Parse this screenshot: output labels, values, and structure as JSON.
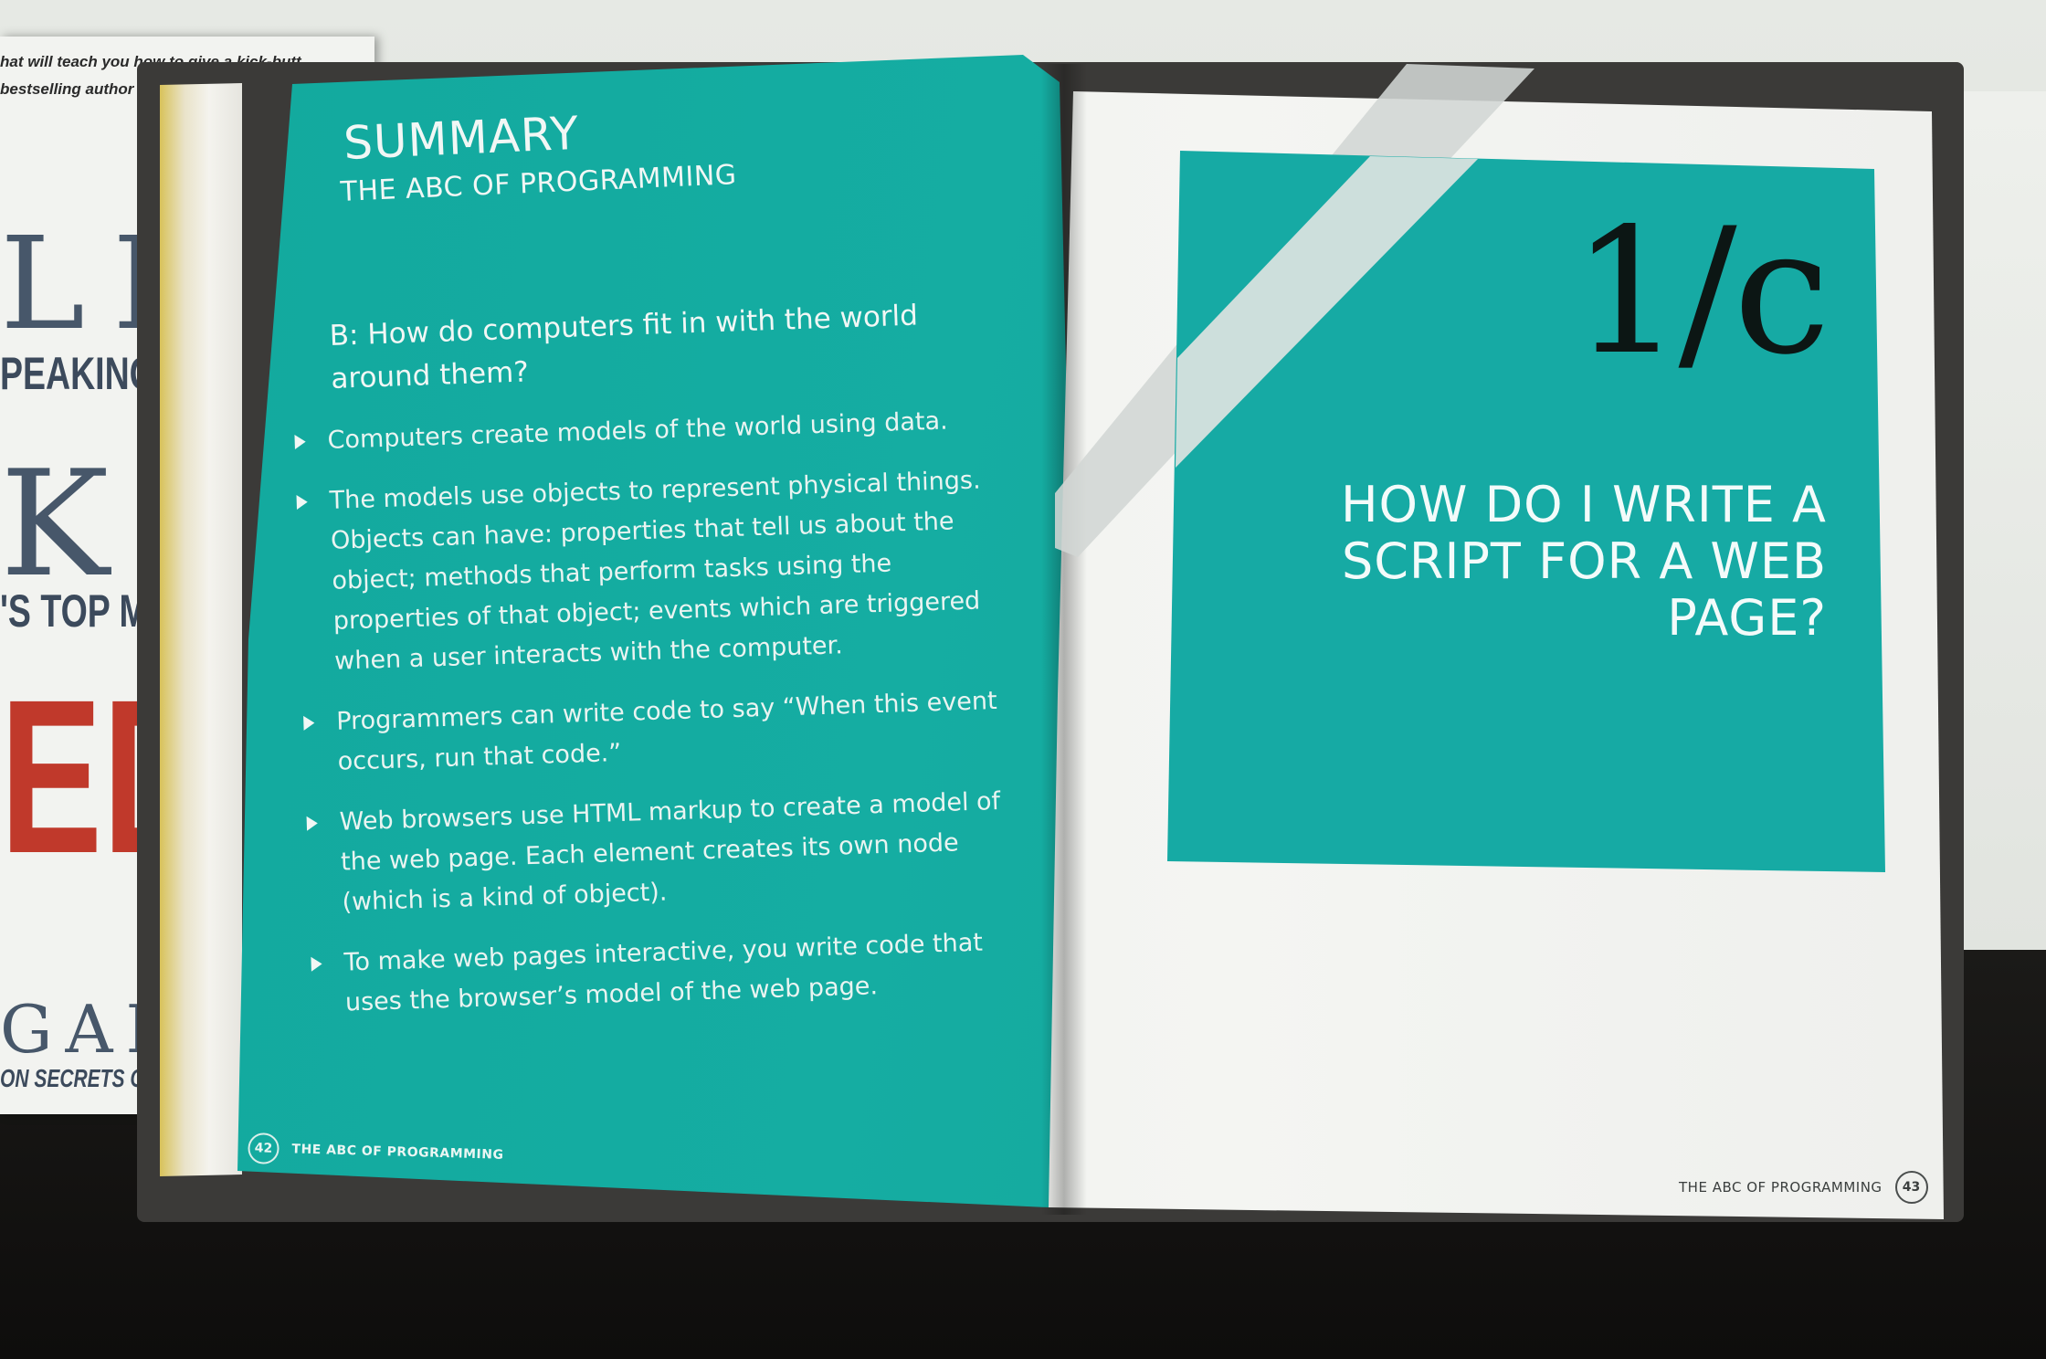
{
  "background_book": {
    "tagline_1": "hat will teach you how to give a kick-butt",
    "tagline_2": "bestselling author of To Sell Is Hu",
    "big_1": "LI",
    "cond_1": "PEAKING SI",
    "big_2": "KI",
    "cond_2": "'S TOP MI",
    "red_text": "ED",
    "big_3": "GAL",
    "cond_3": "ON SECRETS OF"
  },
  "left_page": {
    "title": "SUMMARY",
    "subtitle": "THE ABC OF PROGRAMMING",
    "question": "B: How do computers fit in with the world around them?",
    "bullets": [
      "Computers create models of the world using data.",
      "The models use objects to represent physical things. Objects can have: properties that tell us about the object; methods that perform tasks using the properties of that object; events which are triggered when a user interacts with the computer.",
      "Programmers can write code to say “When this event occurs, run that code.”",
      "Web browsers use HTML markup to create a model of the web page. Each element creates its own node (which is a kind of object).",
      "To make web pages interactive, you write code that uses the browser’s model of the web page."
    ],
    "page_number": "42",
    "footer": "THE ABC OF PROGRAMMING"
  },
  "right_page": {
    "chapter_number": "1/c",
    "chapter_question": "HOW DO I WRITE A SCRIPT FOR A WEB PAGE?",
    "footer": "THE ABC OF PROGRAMMING",
    "page_number": "43"
  },
  "colors": {
    "teal": "#15ada2",
    "page_white": "#f4f5f2",
    "ink_dark": "#0c1614"
  }
}
